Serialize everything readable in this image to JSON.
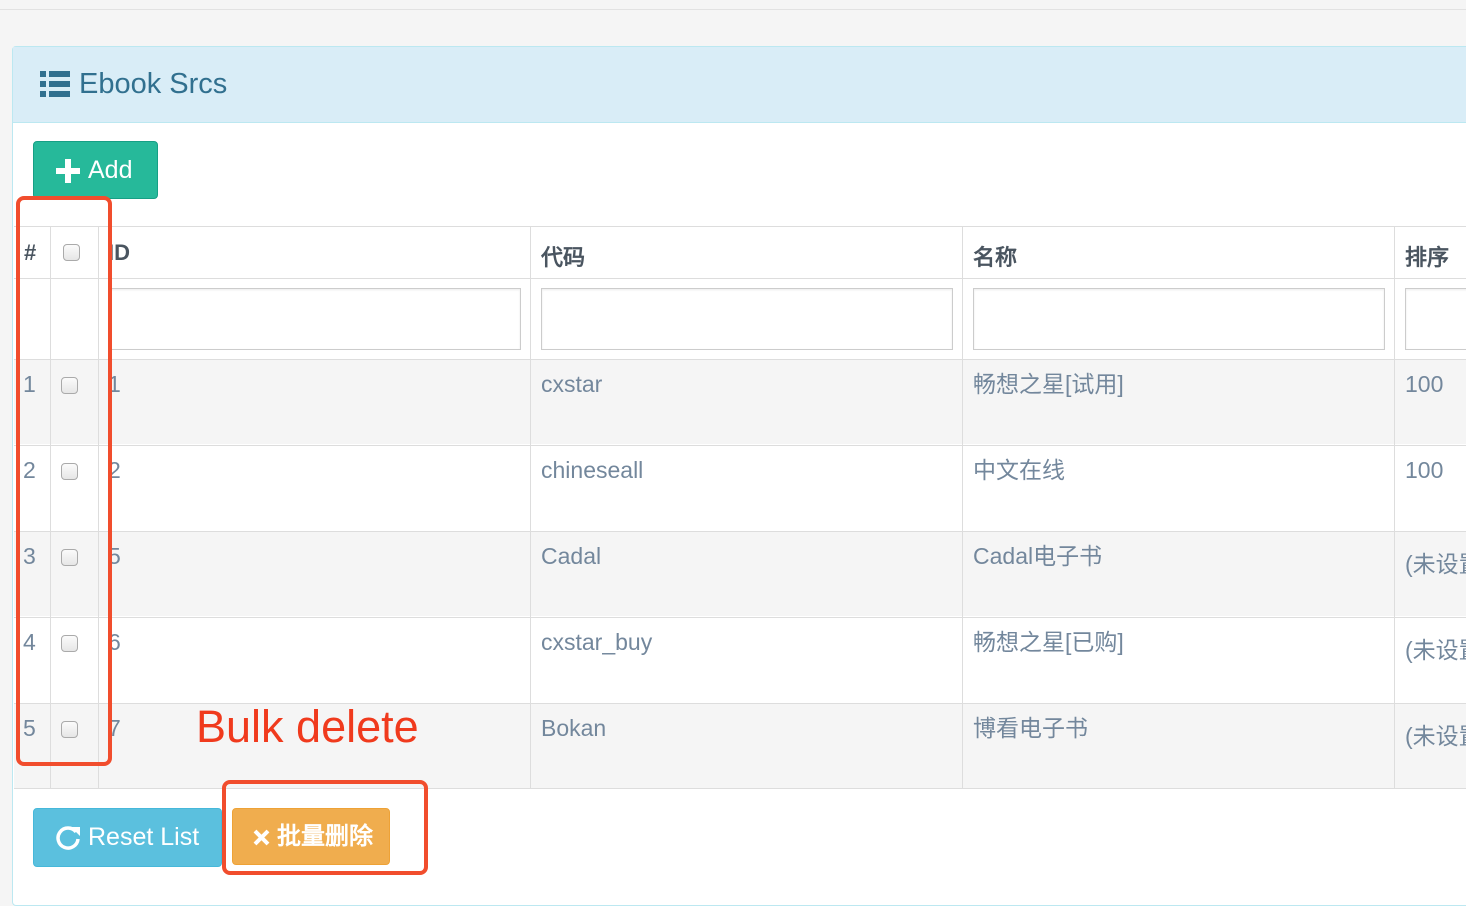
{
  "panel": {
    "title": "Ebook Srcs",
    "title_icon": "list-icon"
  },
  "toolbar": {
    "add_label": "Add",
    "add_icon": "plus-icon"
  },
  "table": {
    "headers": [
      "#",
      "ID",
      "代码",
      "名称",
      "排序"
    ],
    "rows": [
      {
        "num": "1",
        "id": "1",
        "code": "cxstar",
        "name": "畅想之星[试用]",
        "sort": "100"
      },
      {
        "num": "2",
        "id": "2",
        "code": "chineseall",
        "name": "中文在线",
        "sort": "100"
      },
      {
        "num": "3",
        "id": "5",
        "code": "Cadal",
        "name": "Cadal电子书",
        "sort": "(未设置)"
      },
      {
        "num": "4",
        "id": "6",
        "code": "cxstar_buy",
        "name": "畅想之星[已购]",
        "sort": "(未设置)"
      },
      {
        "num": "5",
        "id": "7",
        "code": "Bokan",
        "name": "博看电子书",
        "sort": "(未设置)"
      }
    ]
  },
  "annotation": {
    "text": "Bulk delete",
    "color": "#f03a1d"
  },
  "footer": {
    "reset_label": "Reset List",
    "reset_icon": "refresh-icon",
    "bulk_delete_label": "批量删除",
    "bulk_delete_icon": "close-icon"
  },
  "colors": {
    "heading_bg": "#d9edf7",
    "title": "#31708f",
    "add_btn": "#26b99a",
    "reset_btn": "#5bc0de",
    "bulk_btn": "#f0ad4e",
    "highlight": "#f14d2d"
  }
}
